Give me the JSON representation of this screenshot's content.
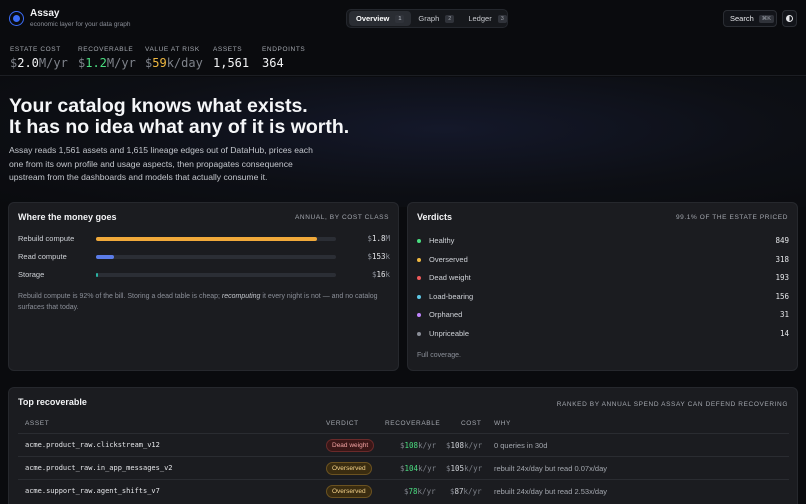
{
  "app": {
    "name": "Assay",
    "tagline": "economic layer for your data graph"
  },
  "tabs": [
    {
      "label": "Overview",
      "key": "1",
      "active": true
    },
    {
      "label": "Graph",
      "key": "2",
      "active": false
    },
    {
      "label": "Ledger",
      "key": "3",
      "active": false
    }
  ],
  "search": {
    "label": "Search",
    "shortcut": "⌘K"
  },
  "metrics": [
    {
      "label": "ESTATE COST",
      "prefix": "$",
      "value": "2.0",
      "unit": "M/yr"
    },
    {
      "label": "RECOVERABLE",
      "prefix": "$",
      "value": "1.2",
      "unit": "M/yr"
    },
    {
      "label": "VALUE AT RISK",
      "prefix": "$",
      "value": "59",
      "unit": "k/day"
    },
    {
      "label": "ASSETS",
      "value": "1,561"
    },
    {
      "label": "ENDPOINTS",
      "value": "364"
    }
  ],
  "hero": {
    "title_line1": "Your catalog knows what exists.",
    "title_line2": "It has no idea what any of it is worth.",
    "body": "Assay reads 1,561 assets and 1,615 lineage edges out of DataHub, prices each one from its own profile and usage aspects, then propagates consequence upstream from the dashboards and models that actually consume it."
  },
  "money": {
    "title": "Where the money goes",
    "aside": "ANNUAL, BY COST CLASS",
    "rows": [
      {
        "label": "Rebuild compute",
        "prefix": "$",
        "value": "1.8",
        "unit": "M",
        "fraction": 0.92,
        "color": "#f0a93a"
      },
      {
        "label": "Read compute",
        "prefix": "$",
        "value": "153",
        "unit": "k",
        "fraction": 0.075,
        "color": "#5b7ce8"
      },
      {
        "label": "Storage",
        "prefix": "$",
        "value": "16",
        "unit": "k",
        "fraction": 0.008,
        "color": "#2bb3a3"
      }
    ],
    "note_before": "Rebuild compute is 92% of the bill. Storing a dead table is cheap; ",
    "note_em": "recomputing",
    "note_after": " it every night is not — and no catalog surfaces that today."
  },
  "verdicts": {
    "title": "Verdicts",
    "aside": "99.1% OF THE ESTATE PRICED",
    "rows": [
      {
        "label": "Healthy",
        "count": "849",
        "color": "#4ade80"
      },
      {
        "label": "Overserved",
        "count": "318",
        "color": "#f0b840"
      },
      {
        "label": "Dead weight",
        "count": "193",
        "color": "#ef5a5a"
      },
      {
        "label": "Load-bearing",
        "count": "156",
        "color": "#5ec8e6"
      },
      {
        "label": "Orphaned",
        "count": "31",
        "color": "#c084fc"
      },
      {
        "label": "Unpriceable",
        "count": "14",
        "color": "#8b8f98"
      }
    ],
    "footer": "Full coverage."
  },
  "recoverable": {
    "title": "Top recoverable",
    "aside": "RANKED BY ANNUAL SPEND ASSAY CAN DEFEND RECOVERING",
    "columns": {
      "asset": "ASSET",
      "verdict": "VERDICT",
      "recoverable": "RECOVERABLE",
      "cost": "COST",
      "why": "WHY"
    },
    "rows": [
      {
        "asset": "acme.product_raw.clickstream_v12",
        "verdict": "Dead weight",
        "verdict_kind": "dead",
        "rec_prefix": "$",
        "rec_value": "108",
        "rec_unit": "k/yr",
        "cost_prefix": "$",
        "cost_value": "108",
        "cost_unit": "k/yr",
        "why": "0 queries in 30d"
      },
      {
        "asset": "acme.product_raw.in_app_messages_v2",
        "verdict": "Overserved",
        "verdict_kind": "over",
        "rec_prefix": "$",
        "rec_value": "104",
        "rec_unit": "k/yr",
        "cost_prefix": "$",
        "cost_value": "105",
        "cost_unit": "k/yr",
        "why": "rebuilt 24x/day but read 0.07x/day"
      },
      {
        "asset": "acme.support_raw.agent_shifts_v7",
        "verdict": "Overserved",
        "verdict_kind": "over",
        "rec_prefix": "$",
        "rec_value": "78",
        "rec_unit": "k/yr",
        "cost_prefix": "$",
        "cost_value": "87",
        "cost_unit": "k/yr",
        "why": "rebuilt 24x/day but read 2.53x/day"
      }
    ]
  }
}
